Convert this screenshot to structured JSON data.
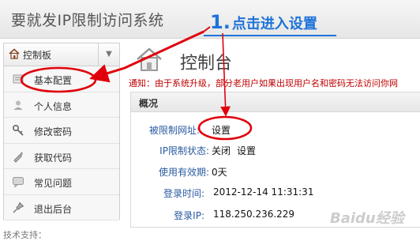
{
  "header": {
    "site_title": "要就发IP限制访问系统",
    "step_number": "1.",
    "step_text": "点击进入设置"
  },
  "sidebar": {
    "header_label": "控制板",
    "dropdown_glyph": "▼",
    "items": [
      {
        "label": "基本配置",
        "icon": "settings-icon"
      },
      {
        "label": "个人信息",
        "icon": "user-icon"
      },
      {
        "label": "修改密码",
        "icon": "key-icon"
      },
      {
        "label": "获取代码",
        "icon": "code-icon"
      },
      {
        "label": "常见问题",
        "icon": "chat-icon"
      },
      {
        "label": "退出后台",
        "icon": "pin-icon"
      }
    ],
    "footer_text": "技术支持："
  },
  "main": {
    "page_title": "控制台",
    "notice": "通知：由于系统升级，部分老用户如果出现用户名和密码无法访问你网",
    "panel_title": "概况",
    "rows": [
      {
        "label": "被限制网址:",
        "value": "设置"
      },
      {
        "label": "IP限制状态:",
        "value_status": "关闭",
        "value_link": "设置"
      },
      {
        "label": "使用有效期:",
        "value": "0天"
      },
      {
        "label": "登录时间:",
        "value": "2012-12-14 11:31:31"
      },
      {
        "label": "登录IP:",
        "value": "118.250.236.229"
      }
    ]
  },
  "watermark": "Baidu经验",
  "colors": {
    "annotation_red": "#e0000b",
    "annotation_blue": "#1e73d8",
    "notice_red": "#c00000",
    "label_blue": "#2a5aa0"
  }
}
